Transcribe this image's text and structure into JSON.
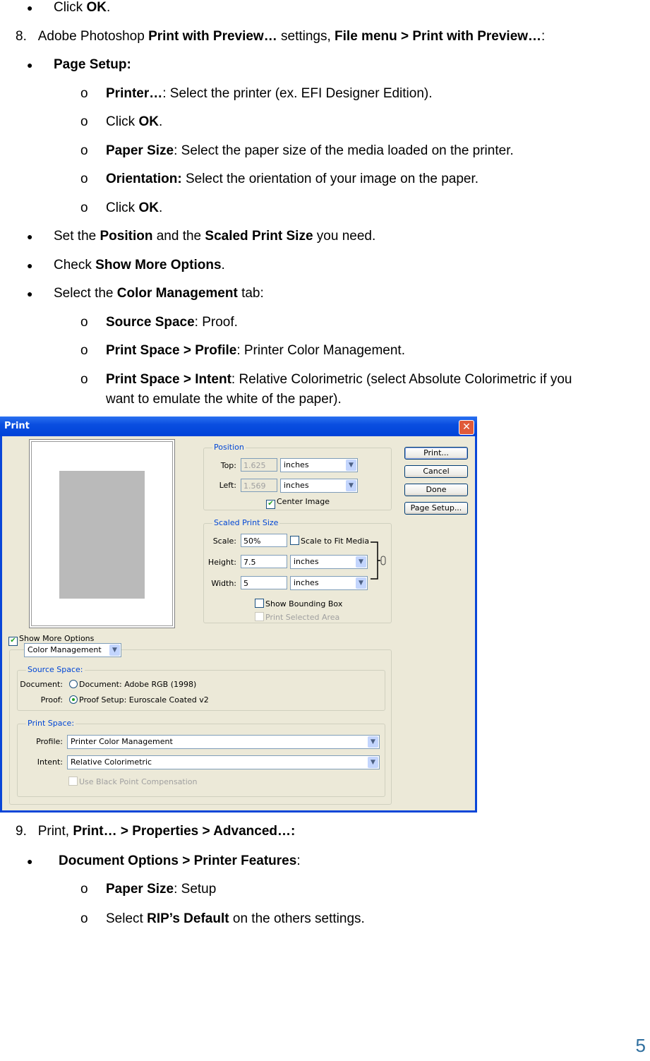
{
  "top_bullet": {
    "pre": "Click ",
    "b": "OK",
    "post": "."
  },
  "step8": {
    "num": "8.",
    "pre": "Adobe Photoshop ",
    "b1": "Print with Preview…",
    "mid": " settings, ",
    "b2": "File menu > Print with Preview…",
    "post": ":"
  },
  "page_setup": {
    "b": "Page Setup:"
  },
  "ps_items": [
    {
      "b": "Printer…",
      "post": ": Select the printer (ex. EFI Designer Edition)."
    },
    {
      "pre": "Click ",
      "b": "OK",
      "post": "."
    },
    {
      "b": "Paper Size",
      "post": ": Select the paper size of the media loaded on the printer."
    },
    {
      "b": "Orientation:",
      "post": " Select the orientation of your image on the paper."
    },
    {
      "pre": "Click ",
      "b": "OK",
      "post": "."
    }
  ],
  "bullets8": [
    {
      "pre": "Set the ",
      "b1": "Position",
      "mid": " and the ",
      "b2": "Scaled Print Size",
      "post": " you need."
    },
    {
      "pre": "Check ",
      "b1": "Show More Options",
      "post": "."
    },
    {
      "pre": "Select the ",
      "b1": "Color Management",
      "post": " tab:"
    }
  ],
  "cm_items": [
    {
      "b": "Source Space",
      "post": ": Proof."
    },
    {
      "b": "Print Space > Profile",
      "post": ": Printer Color Management."
    },
    {
      "b": "Print Space > Intent",
      "post": ": Relative Colorimetric (select Absolute Colorimetric if you",
      "post2": "want to emulate the white of the paper)."
    }
  ],
  "dialog": {
    "title": "Print",
    "close": "✕",
    "position": {
      "legend": "Position",
      "top_label": "Top:",
      "top_value": "1.625",
      "top_unit": "inches",
      "left_label": "Left:",
      "left_value": "1.569",
      "left_unit": "inches",
      "center_image": "Center Image"
    },
    "scaled": {
      "legend": "Scaled Print Size",
      "scale_label": "Scale:",
      "scale_value": "50%",
      "scale_fit": "Scale to Fit Media",
      "height_label": "Height:",
      "height_value": "7.5",
      "height_unit": "inches",
      "width_label": "Width:",
      "width_value": "5",
      "width_unit": "inches",
      "show_bounding": "Show Bounding Box",
      "print_selected": "Print Selected Area"
    },
    "buttons": {
      "print": "Print...",
      "cancel": "Cancel",
      "done": "Done",
      "page_setup": "Page Setup..."
    },
    "show_more": "Show More Options",
    "mode_select": "Color Management",
    "source": {
      "legend": "Source Space:",
      "doc_label": "Document:",
      "doc_option": "Document:  Adobe RGB (1998)",
      "proof_label": "Proof:",
      "proof_option": "Proof Setup:  Euroscale Coated v2"
    },
    "print_space": {
      "legend": "Print Space:",
      "profile_label": "Profile:",
      "profile_value": "Printer Color Management",
      "intent_label": "Intent:",
      "intent_value": "Relative Colorimetric",
      "black_point": "Use Black Point Compensation"
    }
  },
  "step9": {
    "num": "9.",
    "pre": "Print, ",
    "b": "Print… > Properties > Advanced…:"
  },
  "doc_options": {
    "b": "Document Options > Printer Features",
    "post": ":"
  },
  "s9_items": [
    {
      "b": "Paper Size",
      "post": ": Setup"
    },
    {
      "pre": "Select ",
      "b": "RIP’s Default",
      "post": " on the others settings."
    }
  ],
  "page_number": "5"
}
